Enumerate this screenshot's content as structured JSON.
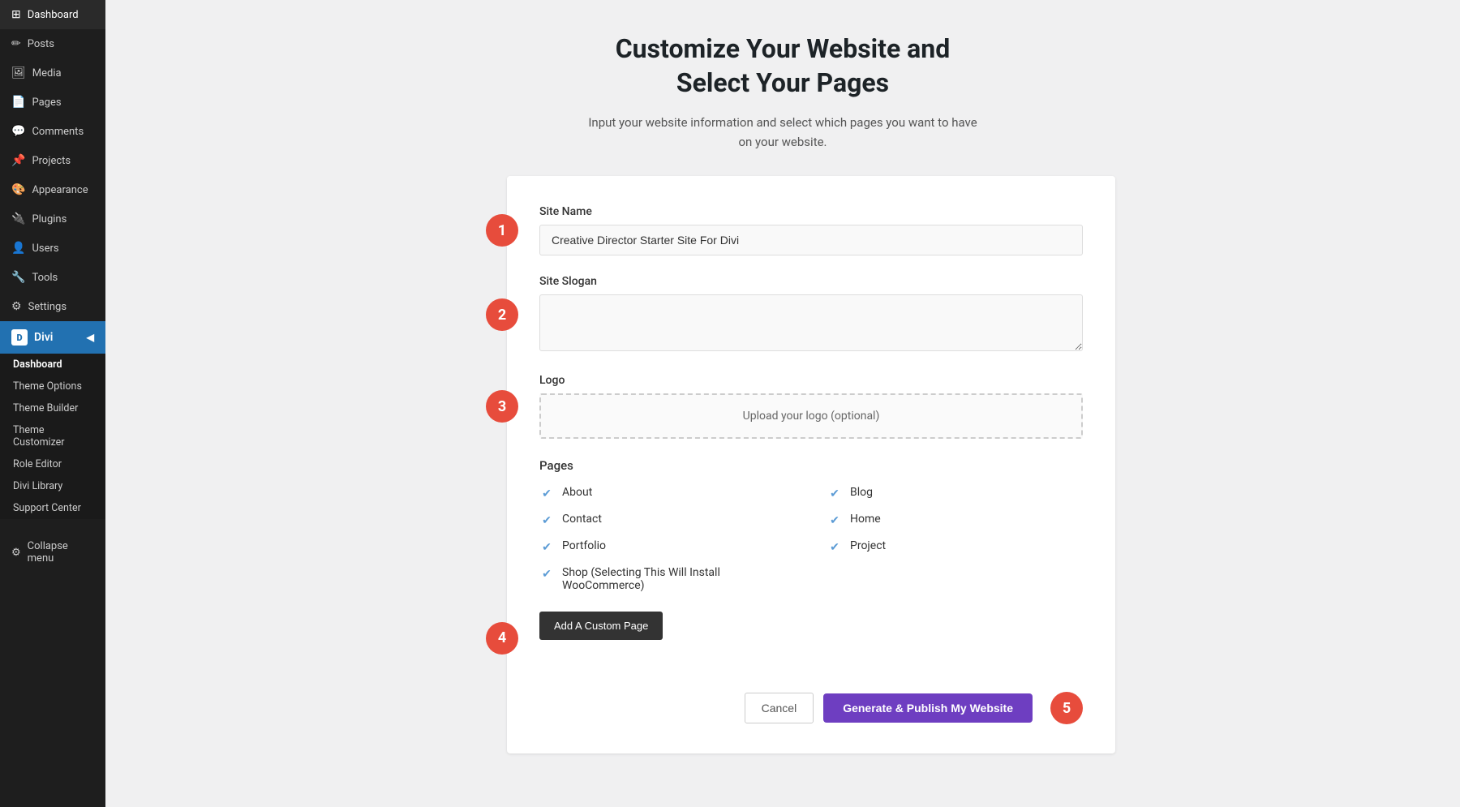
{
  "sidebar": {
    "items": [
      {
        "id": "dashboard",
        "label": "Dashboard",
        "icon": "⊞"
      },
      {
        "id": "posts",
        "label": "Posts",
        "icon": "✏"
      },
      {
        "id": "media",
        "label": "Media",
        "icon": "🖼"
      },
      {
        "id": "pages",
        "label": "Pages",
        "icon": "📄"
      },
      {
        "id": "comments",
        "label": "Comments",
        "icon": "💬"
      },
      {
        "id": "projects",
        "label": "Projects",
        "icon": "📌"
      },
      {
        "id": "appearance",
        "label": "Appearance",
        "icon": "🎨"
      },
      {
        "id": "plugins",
        "label": "Plugins",
        "icon": "🔌"
      },
      {
        "id": "users",
        "label": "Users",
        "icon": "👤"
      },
      {
        "id": "tools",
        "label": "Tools",
        "icon": "🔧"
      },
      {
        "id": "settings",
        "label": "Settings",
        "icon": "⚙"
      }
    ],
    "divi": {
      "label": "Divi",
      "sub_items": [
        {
          "id": "dashboard",
          "label": "Dashboard"
        },
        {
          "id": "theme-options",
          "label": "Theme Options"
        },
        {
          "id": "theme-builder",
          "label": "Theme Builder"
        },
        {
          "id": "theme-customizer",
          "label": "Theme Customizer"
        },
        {
          "id": "role-editor",
          "label": "Role Editor"
        },
        {
          "id": "divi-library",
          "label": "Divi Library"
        },
        {
          "id": "support-center",
          "label": "Support Center"
        }
      ]
    },
    "collapse_label": "Collapse menu"
  },
  "main": {
    "title": "Customize Your Website and\nSelect Your Pages",
    "subtitle": "Input your website information and select which pages you want to have\non your website.",
    "form": {
      "site_name_label": "Site Name",
      "site_name_value": "Creative Director Starter Site For Divi",
      "site_slogan_label": "Site Slogan",
      "site_slogan_value": "",
      "logo_label": "Logo",
      "logo_upload_text": "Upload your logo (optional)",
      "pages_label": "Pages",
      "pages": [
        {
          "id": "about",
          "label": "About",
          "checked": true
        },
        {
          "id": "blog",
          "label": "Blog",
          "checked": true
        },
        {
          "id": "contact",
          "label": "Contact",
          "checked": true
        },
        {
          "id": "home",
          "label": "Home",
          "checked": true
        },
        {
          "id": "portfolio",
          "label": "Portfolio",
          "checked": true
        },
        {
          "id": "project",
          "label": "Project",
          "checked": true
        },
        {
          "id": "shop",
          "label": "Shop (Selecting This Will Install WooCommerce)",
          "checked": true
        }
      ],
      "add_page_btn": "Add A Custom Page",
      "cancel_btn": "Cancel",
      "publish_btn": "Generate & Publish My Website"
    },
    "steps": [
      "1",
      "2",
      "3",
      "4",
      "5"
    ]
  }
}
